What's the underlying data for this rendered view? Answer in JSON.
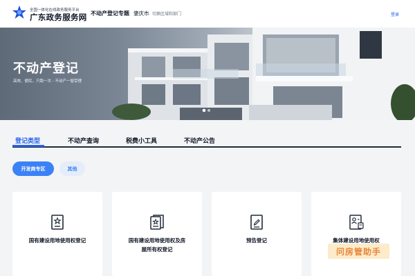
{
  "header": {
    "logo_subtitle": "全国一体化在线政务服务平台",
    "logo_title": "广东政务服务网",
    "topic": "不动产登记专题",
    "city": "肇庆市",
    "switch_region": "切换区域和部门",
    "login": "登录"
  },
  "banner": {
    "title": "不动产登记",
    "subtitle": "高效、便民，只跑一次 - 不动产一窗受理"
  },
  "tabs": [
    {
      "label": "登记类型",
      "active": true
    },
    {
      "label": "不动产查询",
      "active": false
    },
    {
      "label": "税费小工具",
      "active": false
    },
    {
      "label": "不动产公告",
      "active": false
    }
  ],
  "filters": [
    {
      "label": "开发商专区",
      "active": true
    },
    {
      "label": "其他",
      "active": false
    }
  ],
  "cards": [
    {
      "icon": "certificate-icon",
      "lines": [
        "国有建设用地使用权登记"
      ]
    },
    {
      "icon": "certificate-stack-icon",
      "lines": [
        "国有建设用地使用权及房",
        "屋所有权登记"
      ]
    },
    {
      "icon": "edit-document-icon",
      "lines": [
        "预告登记"
      ]
    },
    {
      "icon": "id-card-icon",
      "lines": [
        "集体建设用地使用权"
      ]
    }
  ],
  "watermark": "问房管助手",
  "colors": {
    "accent": "#2563eb",
    "pill_primary": "#3b82f6",
    "pill_secondary_bg": "#e5edf9"
  }
}
